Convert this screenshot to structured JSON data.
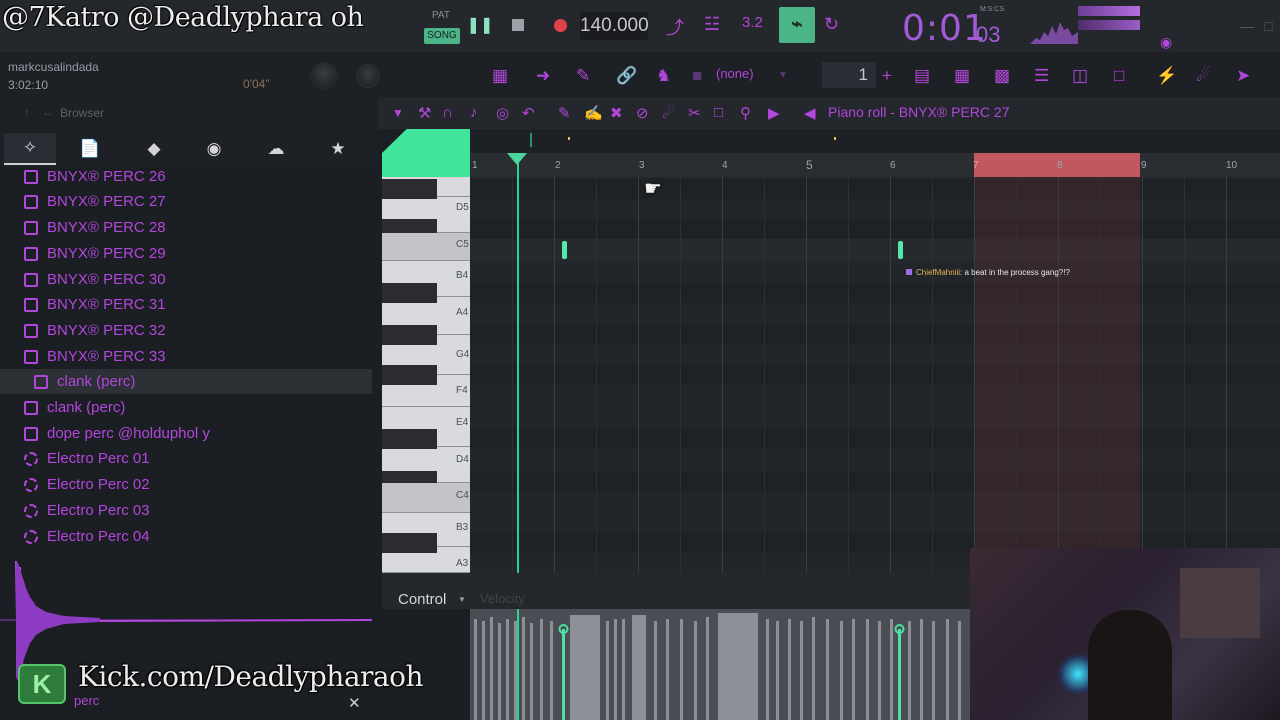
{
  "overlay": {
    "handles": "@7Katro @Deadlyphara oh",
    "kick_url": "Kick.com/Deadlypharaoh",
    "kick_logo": "K",
    "perc_label": "perc"
  },
  "transport": {
    "pat_label": "PAT",
    "song_label": "SONG",
    "tempo": "140.000",
    "step_value": "3.2",
    "time_main": "0:01",
    "time_sub": "03",
    "time_format": "M:S:CS"
  },
  "hint": {
    "user": "markcusalindada",
    "time": "3:02:10",
    "small_time": "0'04\""
  },
  "toolbar2": {
    "pattern_select": "(none)",
    "pattern_number": "1",
    "plus": "+"
  },
  "browser": {
    "label": "Browser",
    "items": [
      {
        "label": "BNYX® PERC 26",
        "type": "file"
      },
      {
        "label": "BNYX® PERC 27",
        "type": "file"
      },
      {
        "label": "BNYX® PERC 28",
        "type": "file"
      },
      {
        "label": "BNYX® PERC 29",
        "type": "file"
      },
      {
        "label": "BNYX® PERC 30",
        "type": "file"
      },
      {
        "label": "BNYX® PERC 31",
        "type": "file"
      },
      {
        "label": "BNYX® PERC 32",
        "type": "file"
      },
      {
        "label": "BNYX® PERC 33",
        "type": "file"
      },
      {
        "label": "clank (perc)",
        "type": "file",
        "selected": true
      },
      {
        "label": "clank (perc)",
        "type": "file"
      },
      {
        "label": "dope perc @holduphol y",
        "type": "file"
      },
      {
        "label": "Electro Perc 01",
        "type": "plugin"
      },
      {
        "label": "Electro Perc 02",
        "type": "plugin"
      },
      {
        "label": "Electro Perc 03",
        "type": "plugin"
      },
      {
        "label": "Electro Perc 04",
        "type": "plugin"
      }
    ]
  },
  "piano_roll": {
    "title": "Piano roll - BNYX® PERC 27",
    "bars": [
      "1",
      "2",
      "3",
      "4",
      "5",
      "6",
      "7",
      "8",
      "9",
      "10"
    ],
    "notes": [
      "D5",
      "C5",
      "B4",
      "A4",
      "G4",
      "F4",
      "E4",
      "D4",
      "C4",
      "B3",
      "A3"
    ],
    "control_label": "Control",
    "velocity_label": "Velocity"
  },
  "chat": {
    "user": "ChiefMahniii",
    "message": ": a beat in the process gang?!?"
  },
  "colors": {
    "accent": "#b247dc",
    "note": "#55e8a6",
    "loop": "#c2585f",
    "song_button": "#4bb588"
  }
}
